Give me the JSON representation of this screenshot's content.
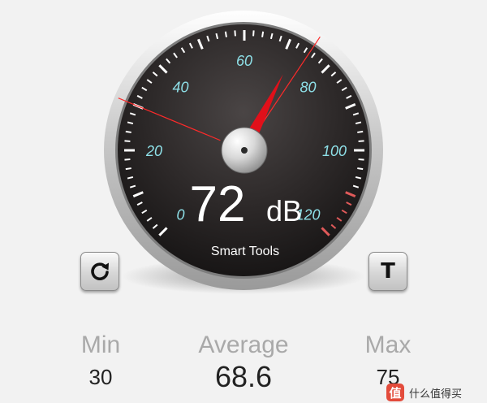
{
  "gauge": {
    "reading_value": "72",
    "reading_unit": "dB",
    "brand": "Smart Tools",
    "scale_min": 0,
    "scale_max": 120,
    "scale_labels": [
      "0",
      "20",
      "40",
      "60",
      "80",
      "100",
      "120"
    ],
    "needle_value": 72,
    "min_marker_value": 30,
    "max_marker_value": 75,
    "colors": {
      "label": "#8ee0e8",
      "needle": "#e0101a",
      "marker": "#ff2a2a",
      "tick": "#ffffff",
      "danger_tick": "#e05a5a"
    }
  },
  "buttons": {
    "reset_icon": "refresh-icon",
    "t_label": "T"
  },
  "stats": {
    "min_label": "Min",
    "min_value": "30",
    "avg_label": "Average",
    "avg_value": "68.6",
    "max_label": "Max",
    "max_value": "75"
  },
  "watermark": {
    "icon_text": "值",
    "text": "什么值得买"
  }
}
